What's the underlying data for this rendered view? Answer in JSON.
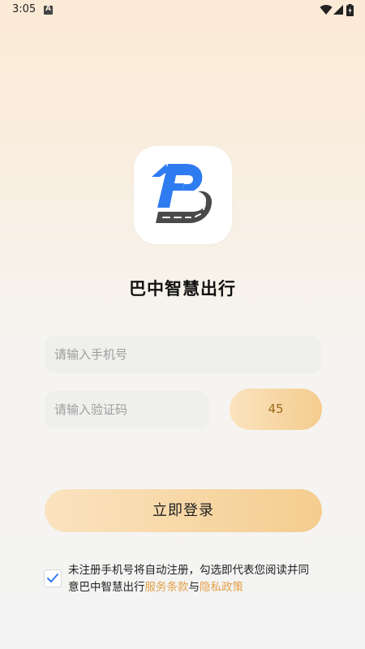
{
  "status_bar": {
    "time": "3:05",
    "notification_icon": "a-icon",
    "icons": [
      "wifi-icon",
      "signal-icon",
      "battery-icon"
    ]
  },
  "app": {
    "logo_icon": "app-logo-b-road-icon",
    "title": "巴中智慧出行"
  },
  "form": {
    "phone_placeholder": "请输入手机号",
    "phone_value": "",
    "code_placeholder": "请输入验证码",
    "code_value": "",
    "countdown_label": "45",
    "login_label": "立即登录"
  },
  "agreement": {
    "checked": true,
    "text_before": "未注册手机号将自动注册，勾选即代表您阅读并同意巴中智慧出行",
    "service_link": "服务条款",
    "conjunction": "与",
    "privacy_link": "隐私政策"
  },
  "colors": {
    "accent_gold": "#f4cc8d",
    "link_orange": "#e3a04a",
    "logo_blue": "#2f7bf0",
    "logo_gray": "#4a4a4a",
    "checkbox_blue": "#2f7bf0"
  }
}
